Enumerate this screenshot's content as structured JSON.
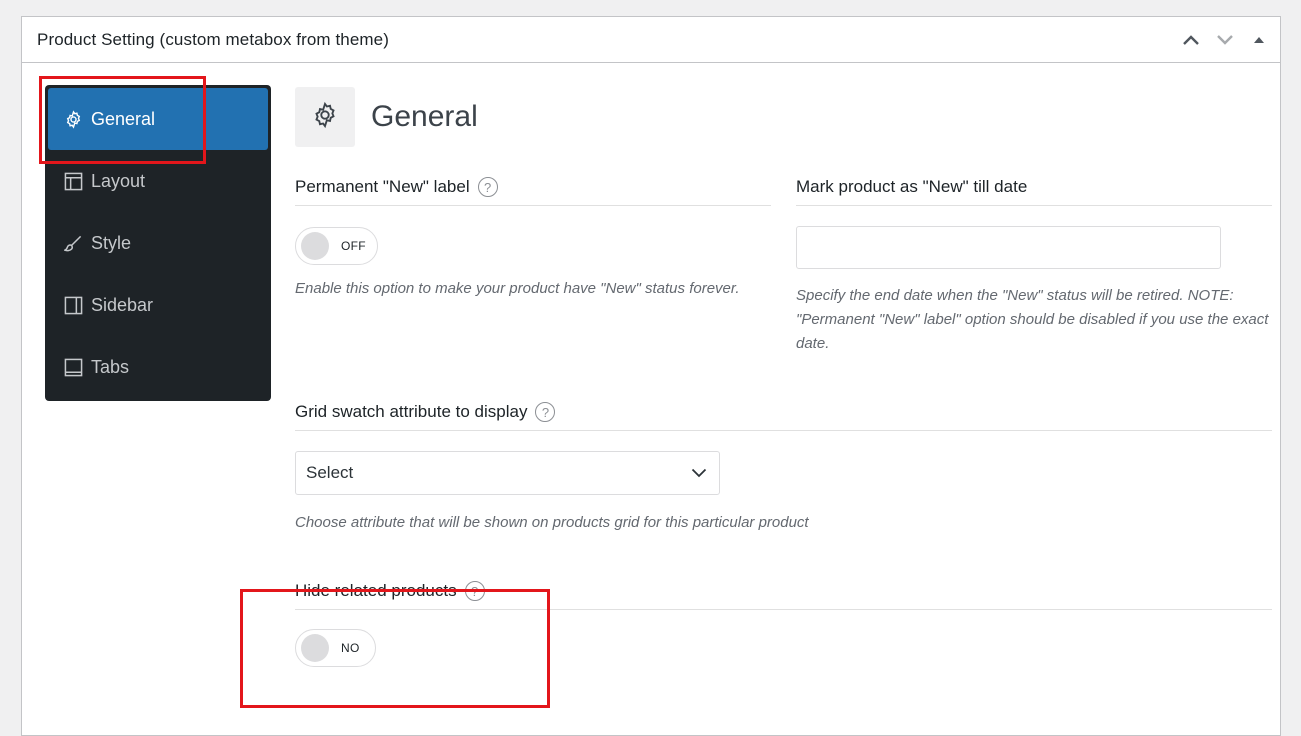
{
  "metabox": {
    "title": "Product Setting (custom metabox from theme)"
  },
  "nav": {
    "items": [
      {
        "label": "General",
        "icon": "gear-icon",
        "active": true
      },
      {
        "label": "Layout",
        "icon": "layout-icon",
        "active": false
      },
      {
        "label": "Style",
        "icon": "brush-icon",
        "active": false
      },
      {
        "label": "Sidebar",
        "icon": "sidebar-icon",
        "active": false
      },
      {
        "label": "Tabs",
        "icon": "tabs-icon",
        "active": false
      }
    ]
  },
  "section": {
    "title": "General"
  },
  "fields": {
    "permanent_new": {
      "label": "Permanent \"New\" label",
      "help": "?",
      "toggle": "OFF",
      "description": "Enable this option to make your product have \"New\" status forever."
    },
    "new_till_date": {
      "label": "Mark product as \"New\" till date",
      "value": "",
      "description": "Specify the end date when the \"New\" status will be retired. NOTE: \"Permanent \"New\" label\" option should be disabled if you use the exact date."
    },
    "grid_swatch": {
      "label": "Grid swatch attribute to display",
      "help": "?",
      "selected": "Select",
      "description": "Choose attribute that will be shown on products grid for this particular product"
    },
    "hide_related": {
      "label": "Hide related products",
      "help": "?",
      "toggle": "NO"
    }
  },
  "colors": {
    "nav_bg": "#1e2327",
    "active": "#2271b1",
    "highlight": "#e3161b"
  }
}
